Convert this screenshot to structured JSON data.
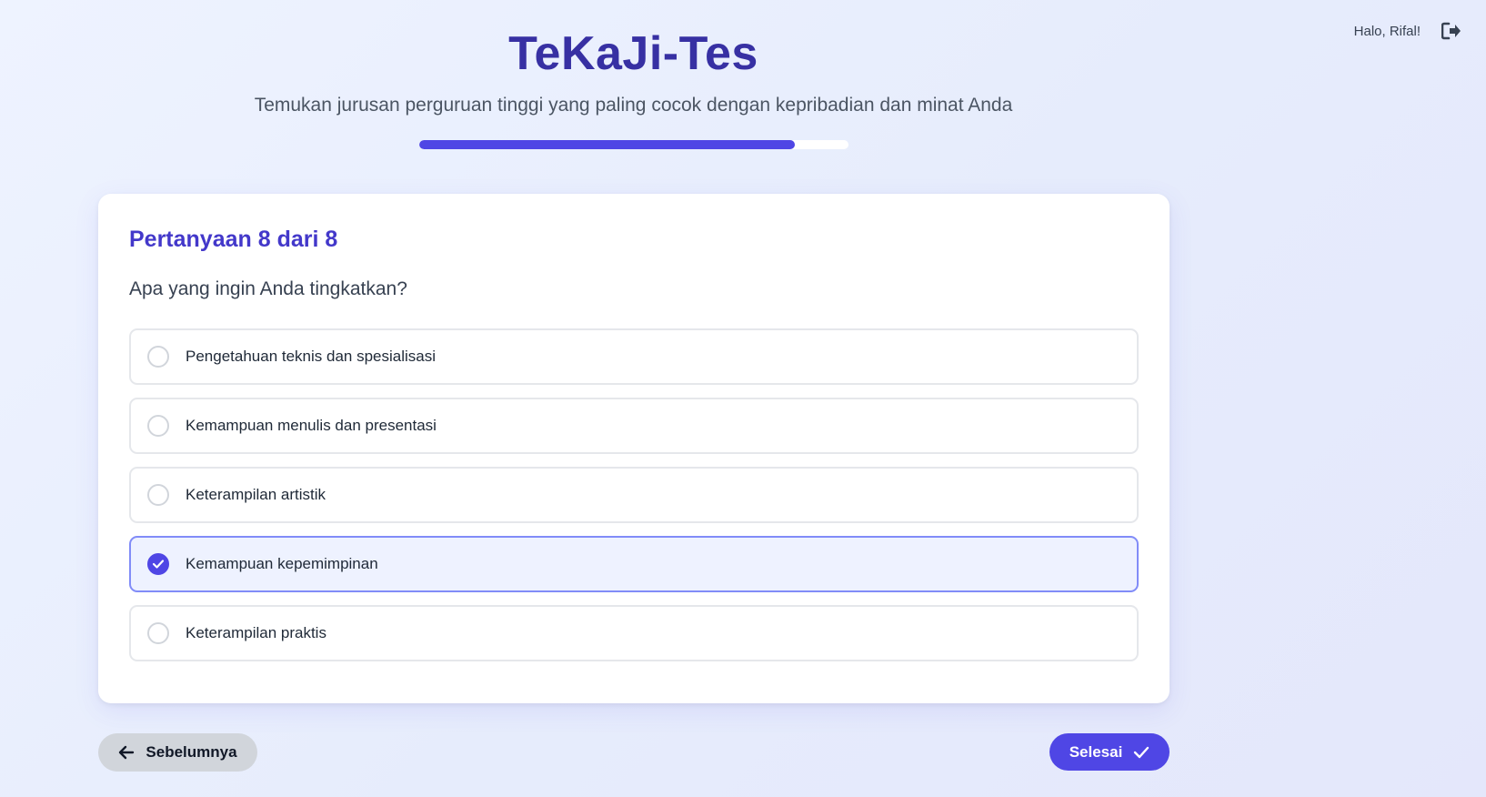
{
  "header": {
    "title": "TeKaJi-Tes",
    "subtitle": "Temukan jurusan perguruan tinggi yang paling cocok dengan kepribadian dan minat Anda",
    "progress_percent": 87.5
  },
  "user": {
    "greeting": "Halo, Rifal!",
    "logout_icon": "logout-icon"
  },
  "question": {
    "number_label": "Pertanyaan 8 dari 8",
    "text": "Apa yang ingin Anda tingkatkan?",
    "options": [
      {
        "label": "Pengetahuan teknis dan spesialisasi",
        "selected": false
      },
      {
        "label": "Kemampuan menulis dan presentasi",
        "selected": false
      },
      {
        "label": "Keterampilan artistik",
        "selected": false
      },
      {
        "label": "Kemampuan kepemimpinan",
        "selected": true
      },
      {
        "label": "Keterampilan praktis",
        "selected": false
      }
    ]
  },
  "navigation": {
    "prev_label": "Sebelumnya",
    "prev_icon": "arrow-left-icon",
    "finish_label": "Selesai",
    "finish_icon": "check-icon"
  },
  "colors": {
    "primary": "#4f46e5",
    "title": "#3730a3",
    "selected_bg": "#eef2ff",
    "selected_border": "#818cf8"
  }
}
